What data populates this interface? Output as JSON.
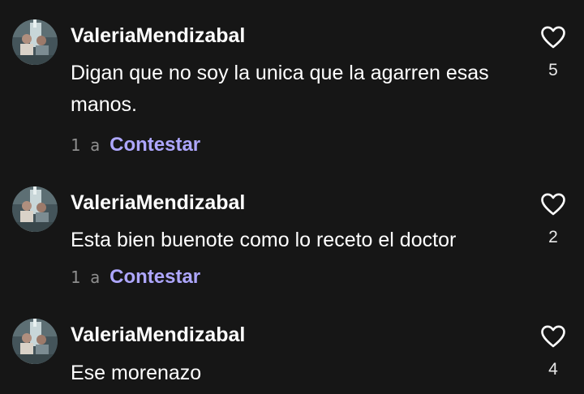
{
  "comments": [
    {
      "username": "ValeriaMendizabal",
      "text": "Digan que no soy la unica que la agarren esas manos.",
      "time": "1 a",
      "reply_label": "Contestar",
      "likes": "5"
    },
    {
      "username": "ValeriaMendizabal",
      "text": "Esta bien buenote como lo receto el doctor",
      "time": "1 a",
      "reply_label": "Contestar",
      "likes": "2"
    },
    {
      "username": "ValeriaMendizabal",
      "text": "Ese morenazo",
      "likes": "4"
    }
  ],
  "icons": {
    "like": "heart-outline-icon",
    "avatar": "profile-photo"
  },
  "colors": {
    "background": "#161616",
    "reply_accent": "#aea7ff",
    "timestamp": "#8e8e8e"
  }
}
